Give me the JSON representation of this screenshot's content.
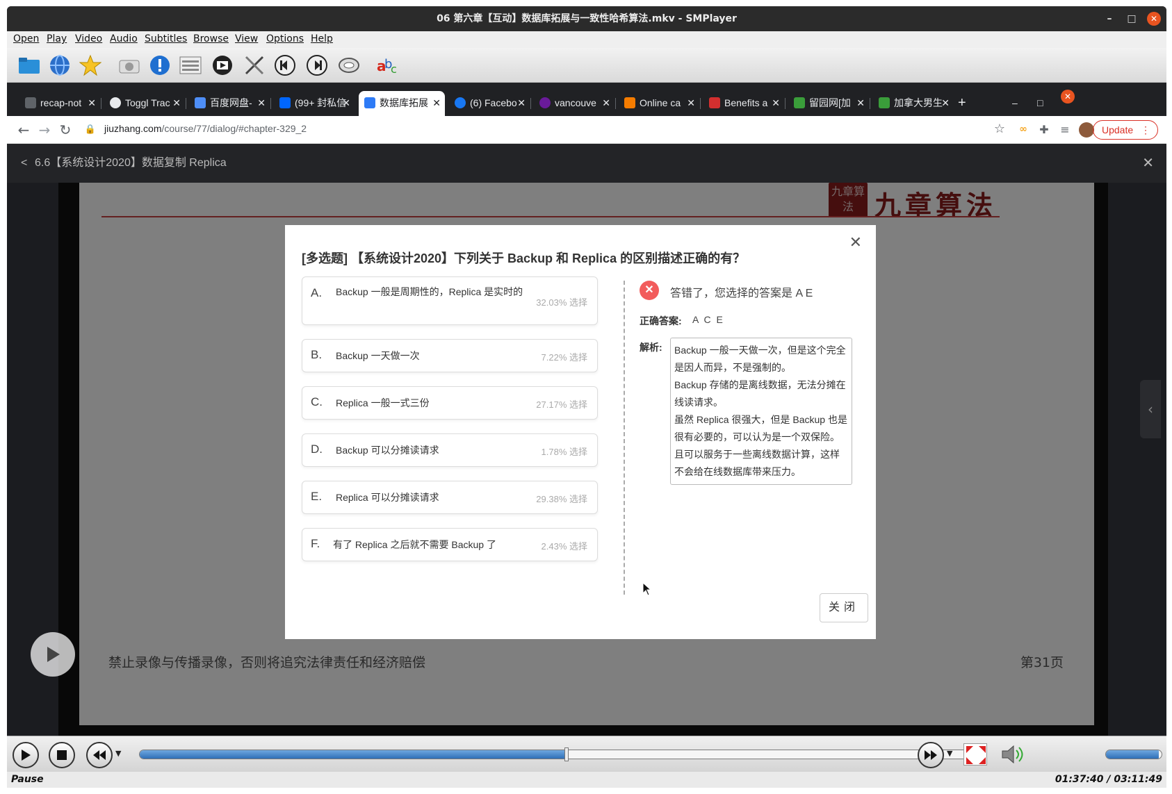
{
  "window": {
    "title": "06 第六章【互动】数据库拓展与一致性哈希算法.mkv - SMPlayer"
  },
  "menubar": [
    "Open",
    "Play",
    "Video",
    "Audio",
    "Subtitles",
    "Browse",
    "View",
    "Options",
    "Help"
  ],
  "browser": {
    "tabs": [
      {
        "label": "recap-not",
        "color": "#5f6368"
      },
      {
        "label": "Toggl Trac",
        "color": "#e8eaed"
      },
      {
        "label": "百度网盘-",
        "color": "#4e8ef7"
      },
      {
        "label": "(99+ 封私信",
        "color": "#0066ff"
      },
      {
        "label": "数据库拓展",
        "color": "#2e7bf6"
      },
      {
        "label": "(6) Facebo",
        "color": "#1877f2"
      },
      {
        "label": "vancouve",
        "color": "#6a1b9a"
      },
      {
        "label": "Online ca",
        "color": "#f57c00"
      },
      {
        "label": "Benefits a",
        "color": "#d32f2f"
      },
      {
        "label": "留园网[加",
        "color": "#3a9d3a"
      },
      {
        "label": "加拿大男生",
        "color": "#3a9d3a"
      }
    ],
    "url_host": "jiuzhang.com",
    "url_path": "/course/77/dialog/#chapter-329_2",
    "update_label": "Update"
  },
  "course": {
    "header_title": "6.6【系统设计2020】数据复制 Replica",
    "slide_footer": "禁止录像与传播录像，否则将追究法律责任和经济赔偿",
    "slide_page": "第31页",
    "slide_logo": "九章算法",
    "slide_seal": "九章算法"
  },
  "quiz": {
    "question": "[多选题]  【系统设计2020】下列关于 Backup 和 Replica 的区别描述正确的有？",
    "options": [
      {
        "letter": "A.",
        "text": "Backup 一般是周期性的，Replica 是实时的",
        "pct": "32.03% 选择"
      },
      {
        "letter": "B.",
        "text": "Backup 一天做一次",
        "pct": "7.22% 选择"
      },
      {
        "letter": "C.",
        "text": "Replica 一般一式三份",
        "pct": "27.17% 选择"
      },
      {
        "letter": "D.",
        "text": "Backup 可以分摊读请求",
        "pct": "1.78% 选择"
      },
      {
        "letter": "E.",
        "text": "Replica 可以分摊读请求",
        "pct": "29.38% 选择"
      },
      {
        "letter": "F.",
        "text": "有了 Replica 之后就不需要 Backup 了",
        "pct": "2.43% 选择"
      }
    ],
    "result_text": "答错了，您选择的答案是 A E",
    "correct_label": "正确答案:",
    "correct_value": "A C E",
    "explain_label": "解析:",
    "explanation": "Backup 一般一天做一次，但是这个完全是因人而异，不是强制的。\nBackup 存储的是离线数据，无法分摊在线读请求。\n虽然 Replica 很强大，但是 Backup 也是很有必要的，可以认为是一个双保险。且可以服务于一些离线数据计算，这样不会给在线数据库带来压力。",
    "close_label": "关闭"
  },
  "player": {
    "status": "Pause",
    "time": "01:37:40 / 03:11:49",
    "progress": 0.5087,
    "volume": 0.95
  },
  "colors": {
    "accent": "#2f6fb7",
    "error": "#f25c5c",
    "chrome_dark": "#202124",
    "update_red": "#d93025"
  }
}
